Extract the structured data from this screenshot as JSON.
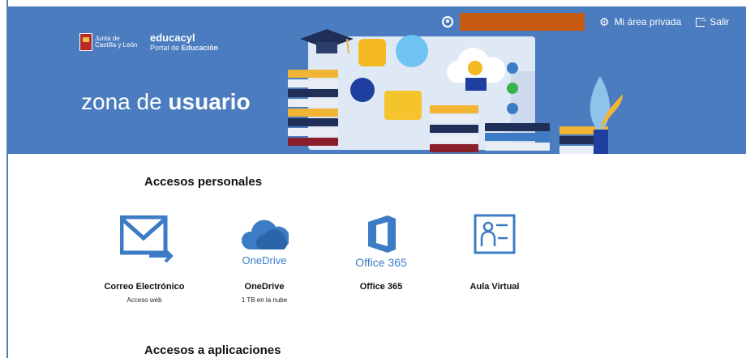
{
  "header": {
    "logo_text": "Junta de Castilla y León",
    "portal_name": "educacyl",
    "portal_sub": "Portal de",
    "portal_sub_bold": "Educación",
    "title_light": "zona de",
    "title_bold": "usuario",
    "private_area_label": "Mi área privada",
    "logout_label": "Salir",
    "colors": {
      "header_bg": "#4a7cbf",
      "redaction": "#c55a11",
      "icon_blue": "#3b7cc4"
    }
  },
  "personal": {
    "title": "Accesos personales",
    "items": [
      {
        "label": "Correo Electrónico",
        "sub": "Acceso web",
        "icon": "mail-icon",
        "brand": ""
      },
      {
        "label": "OneDrive",
        "sub": "1 TB en la nube",
        "icon": "cloud-icon",
        "brand": "OneDrive"
      },
      {
        "label": "Office 365",
        "sub": "",
        "icon": "office-icon",
        "brand": "Office 365"
      },
      {
        "label": "Aula Virtual",
        "sub": "",
        "icon": "classroom-icon",
        "brand": ""
      }
    ]
  },
  "apps": {
    "title": "Accesos a aplicaciones"
  }
}
